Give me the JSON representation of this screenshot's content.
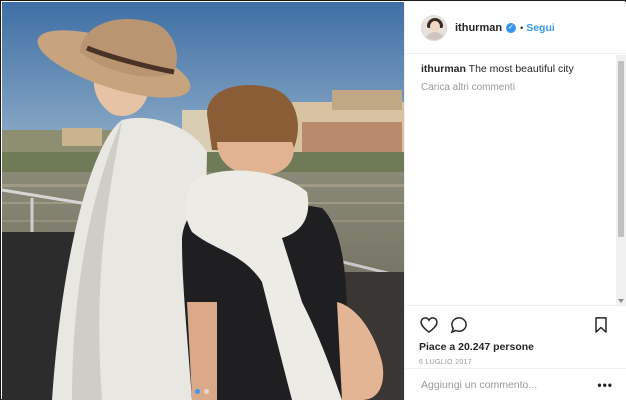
{
  "post": {
    "username": "ithurman",
    "separator": "•",
    "follow_label": "Segui",
    "caption_user": "ithurman",
    "caption_text": " The most beautiful city",
    "load_more_label": "Carica altri commenti",
    "likes_text": "Piace a 20.247 persone",
    "date_text": "6 LUGLIO 2017",
    "comment_placeholder": "Aggiungi un commento...",
    "more_options_label": "•••",
    "verified_mark": "✓",
    "carousel": {
      "total": 2,
      "active_index": 1
    }
  },
  "icons": [
    "heart-icon",
    "comment-icon",
    "bookmark-icon",
    "verified-icon",
    "more-options-icon"
  ],
  "colors": {
    "accent": "#3897f0",
    "text": "#262626",
    "muted": "#999999",
    "border": "#efefef"
  }
}
